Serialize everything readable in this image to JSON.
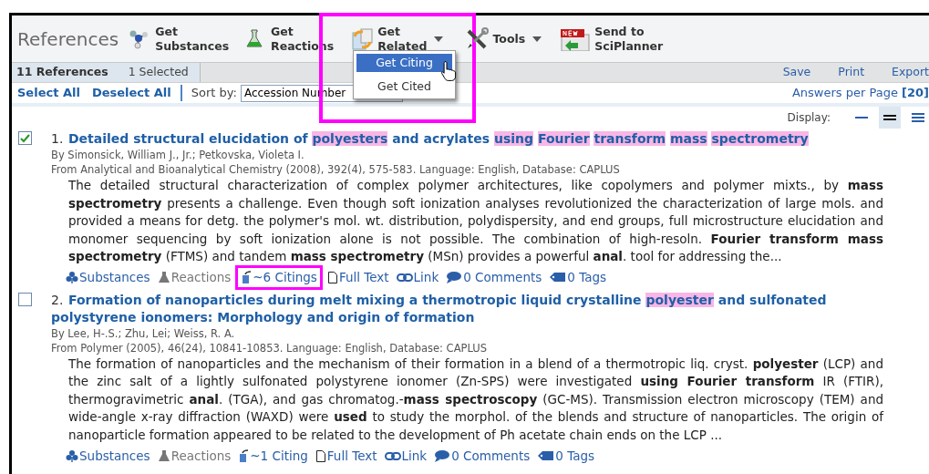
{
  "toolbar": {
    "title": "References",
    "buttons": [
      {
        "kind": "substances",
        "lines": [
          "Get",
          "Substances"
        ],
        "menu": false,
        "annotated": false
      },
      {
        "kind": "reactions",
        "lines": [
          "Get",
          "Reactions"
        ],
        "menu": false,
        "annotated": false
      },
      {
        "kind": "related",
        "lines": [
          "Get",
          "Related"
        ],
        "menu": true,
        "annotated": true
      },
      {
        "kind": "tools",
        "lines": [
          "Tools"
        ],
        "menu": true,
        "annotated": false
      },
      {
        "kind": "sciplanner",
        "lines": [
          "Send to",
          "SciPlanner"
        ],
        "menu": false,
        "annotated": false
      }
    ]
  },
  "dropdown_menu": {
    "items": [
      {
        "label": "Get Citing",
        "selected": true
      },
      {
        "label": "Get Cited",
        "selected": false
      }
    ]
  },
  "summary_bar": {
    "count": "11 References",
    "selected": "1 Selected",
    "actions": [
      "Save",
      "Print",
      "Export"
    ]
  },
  "list_controls": {
    "select_all": "Select All",
    "deselect_all": "Deselect All",
    "sort_label": "Sort by:",
    "sort_value": "Accession Number",
    "answers_label": "Answers per Page",
    "answers_value": "[20]"
  },
  "display": {
    "label": "Display:",
    "options": [
      {
        "kind": "single",
        "selected": false
      },
      {
        "kind": "double",
        "selected": true
      },
      {
        "kind": "triple",
        "selected": false
      }
    ]
  },
  "references": [
    {
      "number": "1.",
      "checked": true,
      "title": [
        {
          "text": "Detailed structural elucidation of",
          "highlighted": false
        },
        {
          "text": "polyesters",
          "highlighted": true
        },
        {
          "text": "and acrylates",
          "highlighted": false
        },
        {
          "text": "using",
          "highlighted": true
        },
        {
          "text": "Fourier",
          "highlighted": true
        },
        {
          "text": "transform",
          "highlighted": true
        },
        {
          "text": "mass",
          "highlighted": true
        },
        {
          "text": "spectrometry",
          "highlighted": true
        }
      ],
      "authors": "By Simonsick, William J., Jr.; Petkovska, Violeta I.",
      "source": "From Analytical and Bioanalytical Chemistry (2008), 392(4), 575-583. Language: English, Database: CAPLUS",
      "abstract": "The detailed structural characterization of complex polymer architectures, like copolymers and polymer mixts., by **mass spectrometry** presents a challenge.  Even though soft ionization analyses revolutionized the characterization of large mols. and provided a means for detg. the polymer's mol. wt. distribution, polydispersity, and end groups, full microstructure elucidation and monomer sequencing by soft ionization alone is not possible.  The combination of high-resoln. **Fourier transform mass spectrometry** (FTMS) and tandem **mass spectrometry** (MSn) provides a powerful **anal**. tool for addressing the...",
      "links": [
        {
          "kind": "substances",
          "label": "Substances",
          "disabled": false,
          "annotated": false
        },
        {
          "kind": "reactions",
          "label": "Reactions",
          "disabled": true,
          "annotated": false
        },
        {
          "kind": "citings",
          "label": "~6 Citings",
          "disabled": false,
          "annotated": true
        },
        {
          "kind": "fulltext",
          "label": "Full Text",
          "disabled": false,
          "annotated": false
        },
        {
          "kind": "link",
          "label": "Link",
          "disabled": false,
          "annotated": false
        },
        {
          "kind": "comments",
          "label": "0 Comments",
          "disabled": false,
          "annotated": false
        },
        {
          "kind": "tags",
          "label": "0 Tags",
          "disabled": false,
          "annotated": false
        }
      ]
    },
    {
      "number": "2.",
      "checked": false,
      "title": [
        {
          "text": "Formation of nanoparticles during melt mixing a thermotropic liquid crystalline",
          "highlighted": false
        },
        {
          "text": "polyester",
          "highlighted": true
        },
        {
          "text": "and sulfonated polystyrene ionomers: Morphology and origin of formation",
          "highlighted": false
        }
      ],
      "authors": "By Lee, H-.S.; Zhu, Lei; Weiss, R. A.",
      "source": "From Polymer (2005), 46(24), 10841-10853. Language: English, Database: CAPLUS",
      "abstract": "The formation of nanoparticles and the mechanism of their formation in a blend of a thermotropic liq. cryst. **polyester** (LCP) and the zinc salt of a lightly sulfonated polystyrene ionomer (Zn-SPS) were investigated **using Fourier transform** IR (FTIR), thermogravimetric **anal**. (TGA), and gas chromatog.-**mass spectroscopy** (GC-MS).  Transmission electron microscopy (TEM) and wide-angle x-ray diffraction (WAXD) were **used** to study the morphol. of the blends and structure of nanoparticles.  The origin of nanoparticle formation appeared to be related to the development of Ph acetate chain ends on the LCP ...",
      "links": [
        {
          "kind": "substances",
          "label": "Substances",
          "disabled": false,
          "annotated": false
        },
        {
          "kind": "reactions",
          "label": "Reactions",
          "disabled": true,
          "annotated": false
        },
        {
          "kind": "citings",
          "label": "~1 Citing",
          "disabled": false,
          "annotated": false
        },
        {
          "kind": "fulltext",
          "label": "Full Text",
          "disabled": false,
          "annotated": false
        },
        {
          "kind": "link",
          "label": "Link",
          "disabled": false,
          "annotated": false
        },
        {
          "kind": "comments",
          "label": "0 Comments",
          "disabled": false,
          "annotated": false
        },
        {
          "kind": "tags",
          "label": "0 Tags",
          "disabled": false,
          "annotated": false
        }
      ]
    }
  ]
}
